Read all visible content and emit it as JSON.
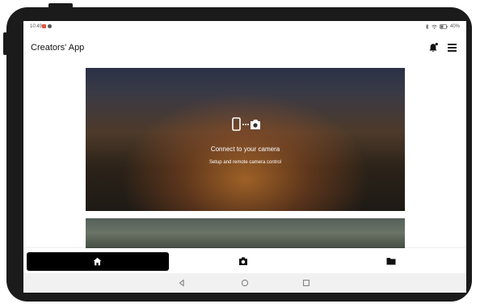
{
  "status_bar": {
    "time": "10:49",
    "battery": "40%"
  },
  "header": {
    "title": "Creators' App",
    "notification_icon": "bell-icon",
    "menu_icon": "hamburger-menu-icon"
  },
  "cards": [
    {
      "icon": "camera-connect-icon",
      "title": "Connect to your camera",
      "subtitle": "Setup and remote camera control"
    }
  ],
  "bottom_nav": {
    "items": [
      {
        "icon": "home-icon",
        "selected": true
      },
      {
        "icon": "camera-icon",
        "selected": false
      },
      {
        "icon": "folder-icon",
        "selected": false
      }
    ]
  },
  "system_nav": {
    "items": [
      "back-icon",
      "home-circle-icon",
      "recents-icon"
    ]
  },
  "colors": {
    "nav_selected_bg": "#000000",
    "background": "#ffffff",
    "device_frame": "#1b1b1b"
  }
}
